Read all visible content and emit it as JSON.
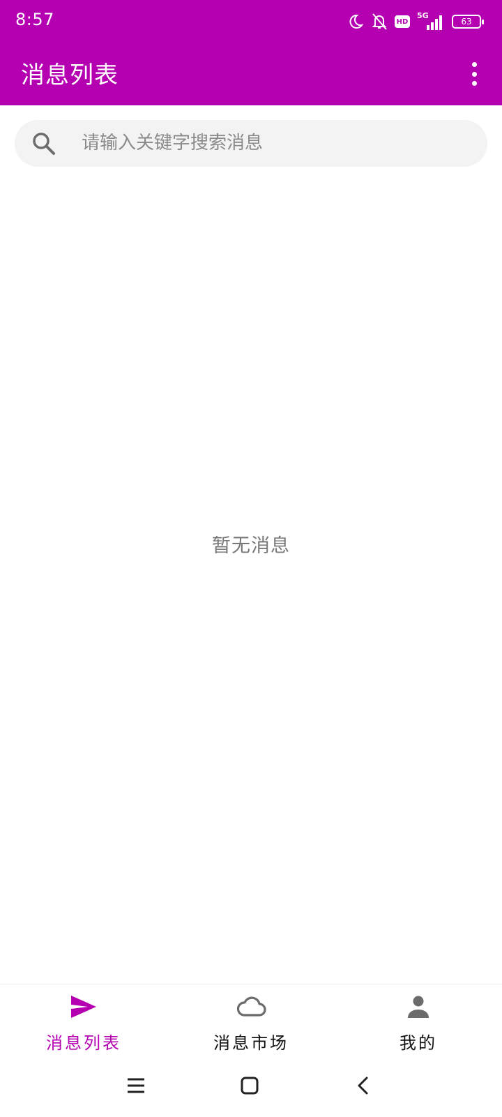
{
  "status_bar": {
    "time": "8:57",
    "network": "5G",
    "hd": "HD",
    "battery": "63",
    "icons": [
      "moon-icon",
      "bell-off-icon",
      "hd-icon",
      "signal-icon",
      "battery-icon"
    ]
  },
  "app_bar": {
    "title": "消息列表",
    "menu_icon": "more-vert-icon"
  },
  "search": {
    "placeholder": "请输入关键字搜索消息",
    "value": ""
  },
  "empty_state": {
    "text": "暂无消息"
  },
  "bottom_nav": {
    "items": [
      {
        "label": "消息列表",
        "icon": "send-icon",
        "active": true
      },
      {
        "label": "消息市场",
        "icon": "cloud-icon",
        "active": false
      },
      {
        "label": "我的",
        "icon": "person-icon",
        "active": false
      }
    ]
  },
  "colors": {
    "primary": "#b400b0",
    "inactive_icon": "#6b6b6b",
    "empty_text": "#777777"
  }
}
